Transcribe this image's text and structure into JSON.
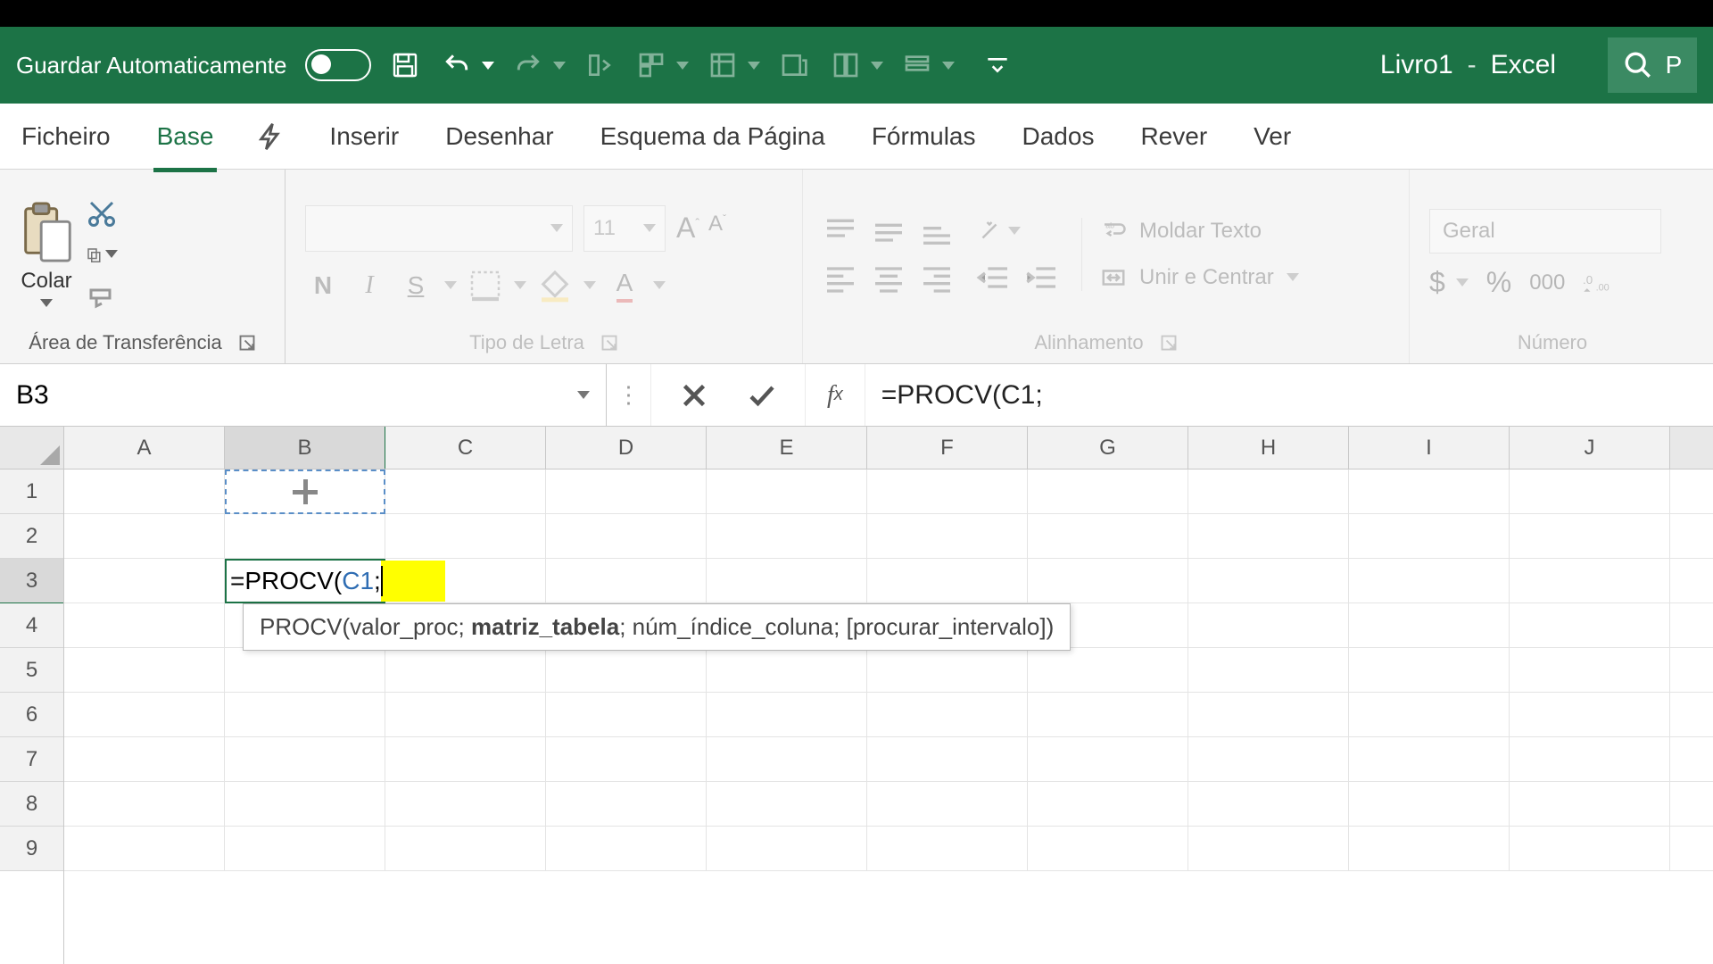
{
  "titlebar": {
    "autosave_label": "Guardar Automaticamente",
    "workbook_name": "Livro1",
    "dash": "-",
    "app_name": "Excel",
    "search_partial": "P"
  },
  "tabs": {
    "file": "Ficheiro",
    "home": "Base",
    "insert": "Inserir",
    "draw": "Desenhar",
    "page_layout": "Esquema da Página",
    "formulas": "Fórmulas",
    "data": "Dados",
    "review": "Rever",
    "view": "Ver"
  },
  "ribbon": {
    "clipboard": {
      "paste": "Colar",
      "group_label": "Área de Transferência"
    },
    "font": {
      "size": "11",
      "group_label": "Tipo de Letra"
    },
    "alignment": {
      "wrap": "Moldar Texto",
      "merge": "Unir e Centrar",
      "group_label": "Alinhamento"
    },
    "number": {
      "format": "Geral",
      "thousands": "000",
      "group_label": "Número"
    }
  },
  "formulabar": {
    "namebox": "B3",
    "formula": "=PROCV(C1;"
  },
  "columns": [
    "A",
    "B",
    "C",
    "D",
    "E",
    "F",
    "G",
    "H",
    "I",
    "J"
  ],
  "rows": [
    "1",
    "2",
    "3",
    "4",
    "5",
    "6",
    "7",
    "8",
    "9"
  ],
  "editing": {
    "prefix": "=PROCV(",
    "ref": "C1",
    "suffix": ";"
  },
  "tooltip": {
    "fn": "PROCV",
    "arg1": "valor_proc",
    "arg2_bold": "matriz_tabela",
    "arg3": "núm_índice_coluna",
    "arg4": "[procurar_intervalo]"
  }
}
